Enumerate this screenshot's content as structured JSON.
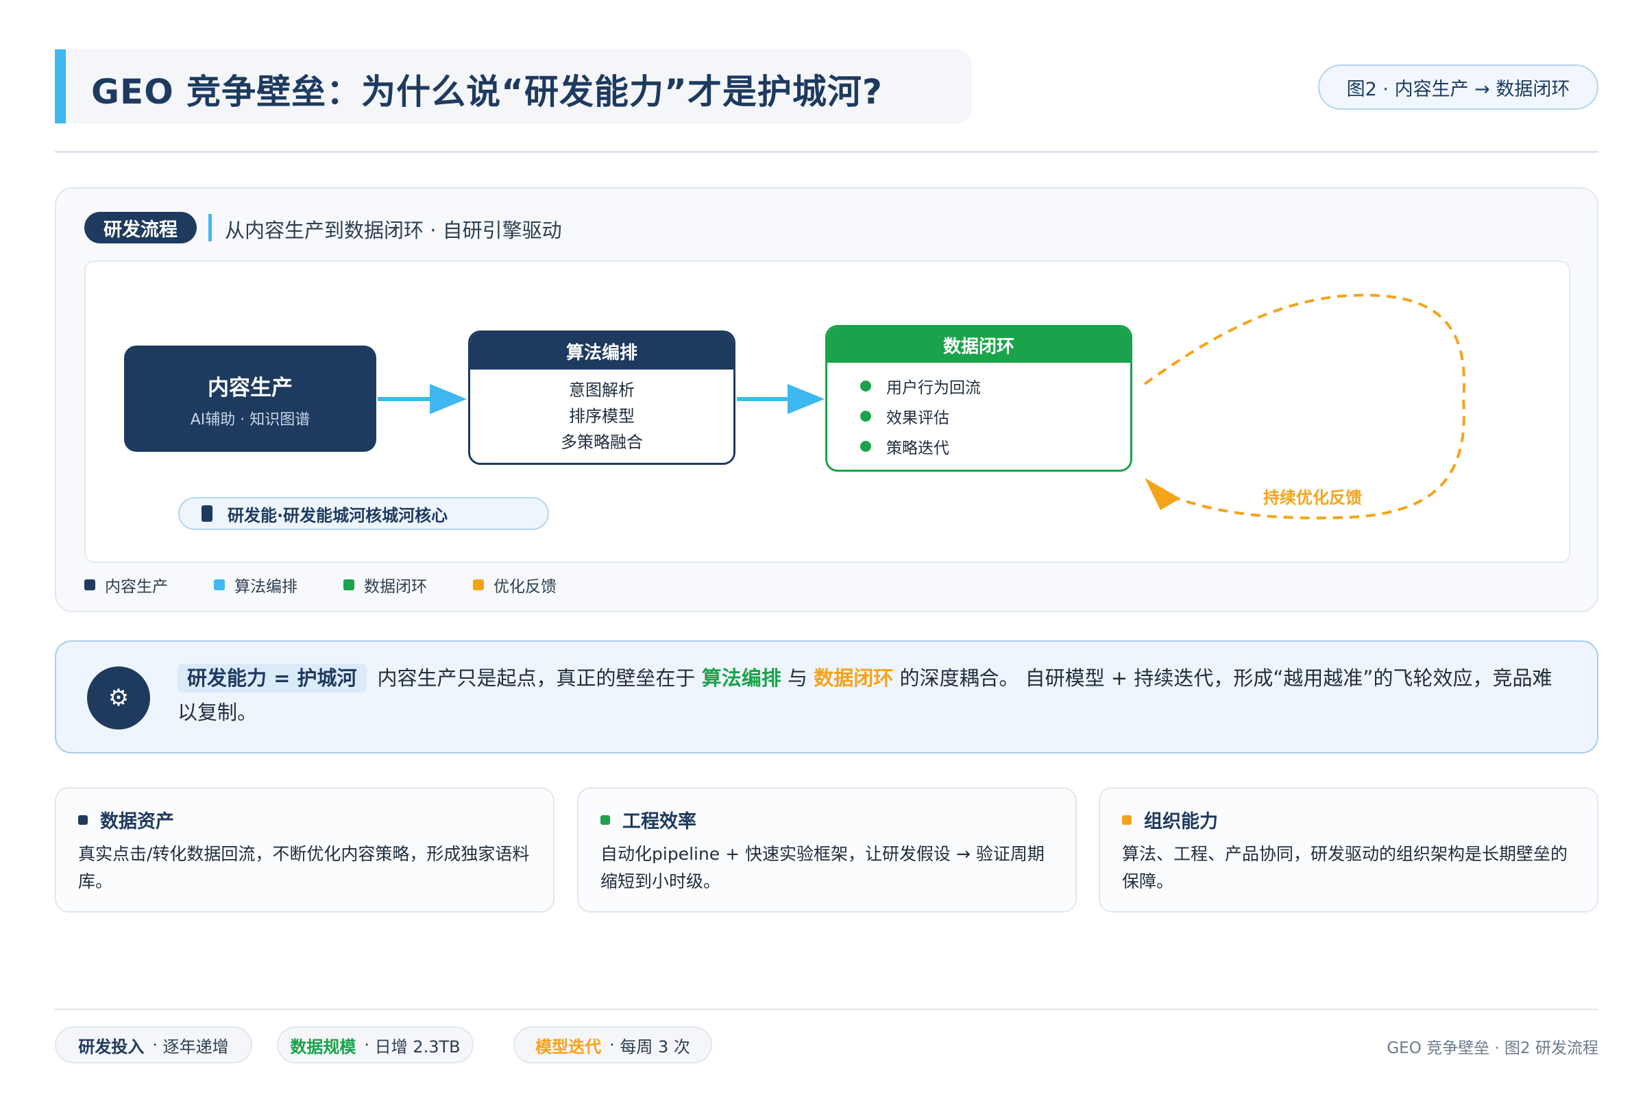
{
  "header": {
    "title": "GEO 竞争壁垒：为什么说“研发能力”才是护城河?",
    "figure_badge": "图2 · 内容生产 → 数据闭环"
  },
  "flow": {
    "tag": "研发流程",
    "subtitle": "从内容生产到数据闭环 · 自研引擎驱动",
    "nodes": {
      "content": {
        "title": "内容生产",
        "subtitle": "AI辅助 · 知识图谱"
      },
      "algorithm": {
        "title": "算法编排",
        "lines": [
          "意图解析",
          "排序模型",
          "多策略融合"
        ]
      },
      "data_loop": {
        "title": "数据闭环",
        "items": [
          "用户行为回流",
          "效果评估",
          "策略迭代"
        ]
      }
    },
    "feedback_label": "持续优化反馈",
    "core_label": "研发能·研发能城河核城河核心",
    "legend": [
      {
        "label": "内容生产",
        "color": "#1e3a5f"
      },
      {
        "label": "算法编排",
        "color": "#3db8f1"
      },
      {
        "label": "数据闭环",
        "color": "#1aa34a"
      },
      {
        "label": "优化反馈",
        "color": "#f5a31a"
      }
    ]
  },
  "insight": {
    "icon": "gear-icon",
    "highlight": "研发能力 = 护城河",
    "text_1": "内容生产只是起点，真正的壁垒在于",
    "term_green": "算法编排",
    "text_2": "与",
    "term_orange": "数据闭环",
    "text_3": "的深度耦合。 自研模型 + 持续迭代，形成“越用越准”的飞轮效应，竞品难以复制。"
  },
  "cards": [
    {
      "title": "数据资产",
      "body": "真实点击/转化数据回流，不断优化内容策略，形成独家语料库。",
      "color": "#1e3a5f"
    },
    {
      "title": "工程效率",
      "body": "自动化pipeline + 快速实验框架，让研发假设 → 验证周期缩短到小时级。",
      "color": "#1aa34a"
    },
    {
      "title": "组织能力",
      "body": "算法、工程、产品协同，研发驱动的组织架构是长期壁垒的保障。",
      "color": "#f5a31a"
    }
  ],
  "footer": {
    "pills": [
      {
        "label": "研发投入",
        "value": "逐年递增",
        "color": "#1e3a5f"
      },
      {
        "label": "数据规模",
        "value": "日增 2.3TB",
        "color": "#1aa34a"
      },
      {
        "label": "模型迭代",
        "value": "每周 3 次",
        "color": "#f5a31a"
      }
    ],
    "sep": "·",
    "right": "GEO 竞争壁垒 · 图2 研发流程"
  }
}
